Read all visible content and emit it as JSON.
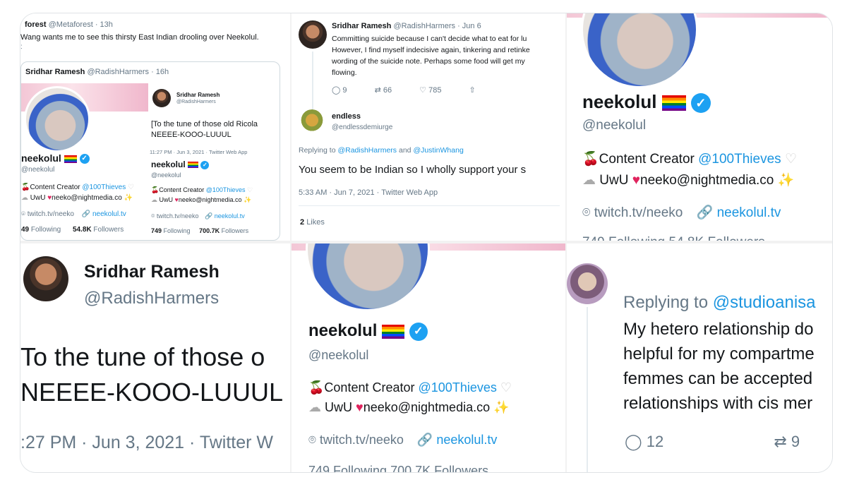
{
  "p1": {
    "top_user": "forest",
    "top_handle": "@Metaforest",
    "top_time": "· 13h",
    "top_text": "Wang wants me to see this thirsty East Indian drooling over Neekolul.",
    "quote_user": "Sridhar Ramesh",
    "quote_handle": "@RadishHarmers",
    "quote_time": "· 16h",
    "profile_name": "neekolul",
    "profile_handle": "@neekolul",
    "bio_prefix": "Content Creator",
    "bio_link": "@100Thieves",
    "bio_line2": "UwU",
    "bio_email": "neeko@nightmedia.co",
    "location": "twitch.tv/neeko",
    "website": "neekolul.tv",
    "following_count": "49",
    "following_label": "Following",
    "followers_count": "54.8K",
    "followers_label": "Followers",
    "inner_user": "Sridhar Ramesh",
    "inner_handle": "@RadishHarmers",
    "inner_text_1": "[To the tune of those old Ricola",
    "inner_text_2": "NEEEE-KOOO-LUUUL",
    "inner_meta": "11:27 PM · Jun 3, 2021 · Twitter Web App",
    "inner_profile_name": "neekolul",
    "inner_profile_handle": "@neekolul",
    "inner_bio_prefix": "Content Creator",
    "inner_bio_link": "@100Thieves",
    "inner_bio_line2": "UwU",
    "inner_bio_email": "neeko@nightmedia.co",
    "inner_location": "twitch.tv/neeko",
    "inner_website": "neekolul.tv",
    "inner_following_count": "749",
    "inner_following_label": "Following",
    "inner_followers_count": "700.7K",
    "inner_followers_label": "Followers"
  },
  "p2": {
    "user": "Sridhar Ramesh",
    "handle": "@RadishHarmers",
    "time": "· Jun 6",
    "text_1": "Committing suicide because I can't decide what to eat for lu",
    "text_2": "However, I find myself indecisive again, tinkering and retinke",
    "text_3": "wording of the suicide note. Perhaps some food will get my",
    "text_4": "flowing.",
    "replies": "9",
    "retweets": "66",
    "likes": "785",
    "reply_user": "endless",
    "reply_handle": "@endlessdemiurge",
    "replying_prefix": "Replying to",
    "replying_to_1": "@RadishHarmers",
    "replying_and": "and",
    "replying_to_2": "@JustinWhang",
    "reply_text": "You seem to be Indian so I wholly support your s",
    "reply_meta": "5:33 AM · Jun 7, 2021 · Twitter Web App",
    "likes_count": "2",
    "likes_label": "Likes"
  },
  "p3": {
    "name": "neekolul",
    "handle": "@neekolul",
    "bio_prefix": "Content Creator",
    "bio_link": "@100Thieves",
    "bio_line2": "UwU",
    "bio_email": "neeko@nightmedia.co",
    "location": "twitch.tv/neeko",
    "website": "neekolul.tv",
    "stats_partial": "749 Following    54.8K Followers"
  },
  "p4": {
    "name": "Sridhar Ramesh",
    "handle": "@RadishHarmers",
    "text_1": "To the tune of those o",
    "text_2": "NEEEE-KOOO-LUUUL",
    "meta": ":27 PM · Jun 3, 2021 · Twitter W"
  },
  "p5": {
    "name": "neekolul",
    "handle": "@neekolul",
    "bio_prefix": "Content Creator",
    "bio_link": "@100Thieves",
    "bio_line2": "UwU",
    "bio_email": "neeko@nightmedia.co",
    "location": "twitch.tv/neeko",
    "website": "neekolul.tv",
    "stats_partial": "749 Following    700.7K Followers"
  },
  "p6": {
    "replying_prefix": "Replying to",
    "replying_to": "@studioanisa",
    "text_1": "My hetero relationship do",
    "text_2": "helpful for my compartme",
    "text_3": "femmes can be accepted",
    "text_4": "relationships with cis mer",
    "replies": "12",
    "retweets": "9"
  },
  "colors": {
    "link": "#1b95e0",
    "muted": "#657786",
    "verified": "#1da1f2",
    "heart": "#e0245e",
    "cherry": "#c8102e"
  },
  "icons": [
    "verified-badge-icon",
    "pride-flag-icon",
    "cherry-icon",
    "cloud-icon",
    "heart-icon",
    "sparkles-icon",
    "white-heart-icon",
    "location-icon",
    "link-icon",
    "reply-icon",
    "retweet-icon",
    "like-icon",
    "share-icon"
  ]
}
